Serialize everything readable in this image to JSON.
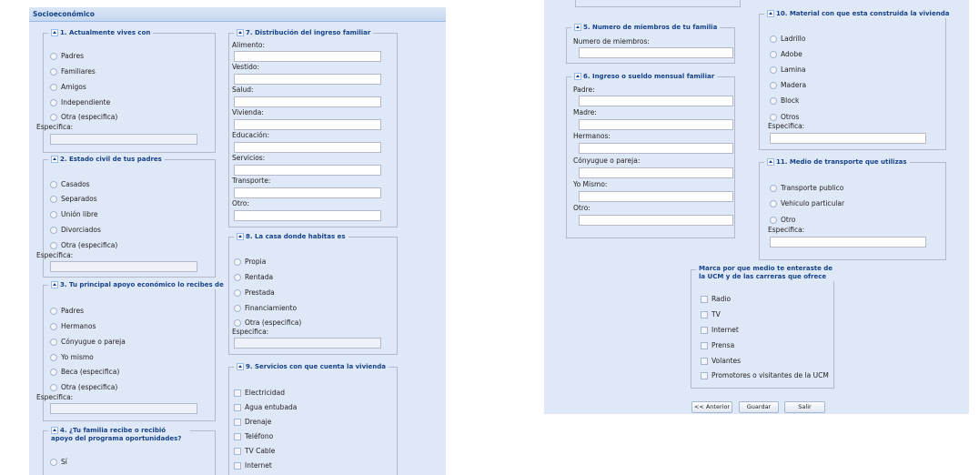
{
  "header": {
    "title": "Socioeconómico"
  },
  "q1": {
    "legend": "1. Actualmente vives con",
    "options": [
      "Padres",
      "Familiares",
      "Amigos",
      "Independiente",
      "Otra (especifica)"
    ],
    "spec_label": "Especifica:"
  },
  "q2": {
    "legend": "2. Estado civil de tus padres",
    "options": [
      "Casados",
      "Separados",
      "Unión libre",
      "Divorciados",
      "Otra (especifica)"
    ],
    "spec_label": "Especifica:"
  },
  "q3": {
    "legend": "3. Tu principal apoyo económico lo recibes de",
    "options": [
      "Padres",
      "Hermanos",
      "Cónyugue o pareja",
      "Yo mismo",
      "Beca (especifica)",
      "Otra (especifica)"
    ],
    "spec_label": "Especifica:"
  },
  "q4": {
    "legend": "4. ¿Tu familia recibe o recibió apoyo del programa oportunidades?",
    "options": [
      "Sí"
    ]
  },
  "q7": {
    "legend": "7. Distribución del ingreso familiar",
    "fields": [
      "Alimento:",
      "Vestido:",
      "Salud:",
      "Vivienda:",
      "Educación:",
      "Servicios:",
      "Transporte:",
      "Otro:"
    ]
  },
  "q8": {
    "legend": "8. La casa donde habitas es",
    "options": [
      "Propia",
      "Rentada",
      "Prestada",
      "Financiamiento",
      "Otra (especifica)"
    ],
    "spec_label": "Especifica:"
  },
  "q9": {
    "legend": "9. Servicios con que cuenta la vivienda",
    "options": [
      "Electricidad",
      "Agua entubada",
      "Drenaje",
      "Teléfono",
      "TV Cable",
      "Internet"
    ]
  },
  "q5": {
    "legend": "5. Numero de miembros de tu familia",
    "field": "Numero de miembros:"
  },
  "q6": {
    "legend": "6. Ingreso o sueldo mensual familiar",
    "fields": [
      "Padre:",
      "Madre:",
      "Hermanos:",
      "Cónyugue o pareja:",
      "Yo Mismo:",
      "Otro:"
    ]
  },
  "q10": {
    "legend": "10. Material con que esta construida la vivienda",
    "options": [
      "Ladrillo",
      "Adobe",
      "Lamina",
      "Madera",
      "Block",
      "Otros"
    ],
    "spec_label": "Especifica:"
  },
  "q11": {
    "legend": "11. Medio de transporte que utilizas",
    "options": [
      "Transporte publico",
      "Vehiculo particular",
      "Otro"
    ],
    "spec_label": "Especifica:"
  },
  "q12": {
    "legend": "Marca por que medio te enteraste de la UCM y de las carreras que ofrece",
    "options": [
      "Radio",
      "TV",
      "Internet",
      "Prensa",
      "Volantes",
      "Promotores o visitantes de la UCM"
    ]
  },
  "buttons": {
    "prev": "<< Anterior",
    "save": "Guardar",
    "exit": "Salir"
  }
}
